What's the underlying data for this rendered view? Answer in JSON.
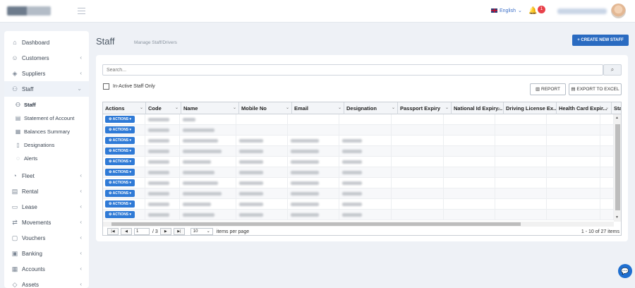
{
  "header": {
    "language": "English",
    "notifications_count": "1"
  },
  "sidebar": {
    "items": [
      {
        "label": "Dashboard",
        "icon": "home-icon",
        "glyph": "⌂",
        "chevron": ""
      },
      {
        "label": "Customers",
        "icon": "users-icon",
        "glyph": "☺",
        "chevron": "‹"
      },
      {
        "label": "Suppliers",
        "icon": "layers-icon",
        "glyph": "◈",
        "chevron": "‹"
      },
      {
        "label": "Staff",
        "icon": "staff-icon",
        "glyph": "⚇",
        "chevron": "⌄"
      },
      {
        "label": "Fleet",
        "icon": "fleet-icon",
        "glyph": "◔",
        "chevron": "‹"
      },
      {
        "label": "Rental",
        "icon": "rental-icon",
        "glyph": "▤",
        "chevron": "‹"
      },
      {
        "label": "Lease",
        "icon": "lease-icon",
        "glyph": "▭",
        "chevron": "‹"
      },
      {
        "label": "Movements",
        "icon": "movements-icon",
        "glyph": "⇄",
        "chevron": "‹"
      },
      {
        "label": "Vouchers",
        "icon": "vouchers-icon",
        "glyph": "▢",
        "chevron": "‹"
      },
      {
        "label": "Banking",
        "icon": "banking-icon",
        "glyph": "▣",
        "chevron": "‹"
      },
      {
        "label": "Accounts",
        "icon": "accounts-icon",
        "glyph": "▦",
        "chevron": "‹"
      },
      {
        "label": "Assets",
        "icon": "assets-icon",
        "glyph": "◇",
        "chevron": "‹"
      }
    ],
    "staff_sub": [
      {
        "label": "Staff",
        "icon": "staff-sub-icon",
        "glyph": "⚇"
      },
      {
        "label": "Statement of Account",
        "icon": "statement-icon",
        "glyph": "▤"
      },
      {
        "label": "Balances Summary",
        "icon": "balances-icon",
        "glyph": "▦"
      },
      {
        "label": "Designations",
        "icon": "designations-icon",
        "glyph": "▯"
      },
      {
        "label": "Alerts",
        "icon": "alerts-icon",
        "glyph": "◌"
      }
    ]
  },
  "page": {
    "title": "Staff",
    "subtitle": "Manage Staff/Drivers",
    "create_label": "+ CREATE NEW STAFF",
    "search_placeholder": "Search...",
    "inactive_label": "In-Active Staff Only",
    "report_label": "REPORT",
    "export_label": "EXPORT TO EXCEL"
  },
  "grid": {
    "columns": [
      "Actions",
      "Code",
      "Name",
      "Mobile No",
      "Email",
      "Designation",
      "Passport Expiry",
      "National Id Expiry...",
      "Driving License Ex...",
      "Health Card Expir...",
      "Sta"
    ],
    "action_label": "ACTIONS",
    "row_count": 10
  },
  "pager": {
    "current_page": "1",
    "total_pages": "/ 3",
    "page_size": "10",
    "items_per_page_label": "items per page",
    "summary": "1 - 10 of 27 items"
  }
}
